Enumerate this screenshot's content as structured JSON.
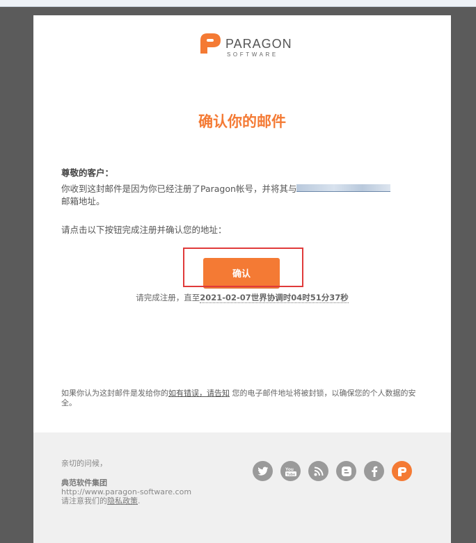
{
  "logo": {
    "name": "PARAGON",
    "sub": "SOFTWARE"
  },
  "headline": "确认你的邮件",
  "greeting": "尊敬的客户：",
  "body": {
    "line1": "你收到这封邮件是因为你已经注册了Paragon帐号，并将其与",
    "line2": "邮箱地址。"
  },
  "instruction": "请点击以下按钮完成注册并确认您的地址：",
  "confirm_button": "确认",
  "deadline": {
    "prefix": "请完成注册，直至",
    "date": "2021-02-07世界协调时04时51分37秒"
  },
  "notice": {
    "part1": "如果你认为这封邮件是发给你的",
    "link": "如有错误，请告知",
    "part2": " 您的电子邮件地址将被封锁，以确保您的个人数据的安全。"
  },
  "footer": {
    "regards": "亲切的问候，",
    "company": "典范软件集团",
    "website": "http://www.paragon-software.com",
    "privacy_prefix": "请注意我们的",
    "privacy_link": "隐私政策",
    "privacy_suffix": "."
  },
  "socials": [
    "twitter-icon",
    "youtube-icon",
    "rss-icon",
    "blogger-icon",
    "facebook-icon",
    "paragon-icon"
  ],
  "colors": {
    "accent": "#f47a34",
    "highlight": "#e03a3a",
    "background": "#5b5b5b"
  }
}
